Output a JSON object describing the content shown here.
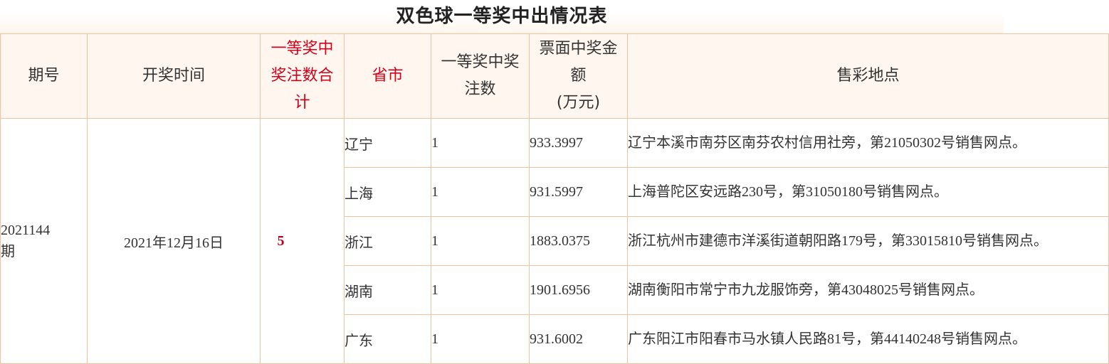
{
  "title": "双色球一等奖中出情况表",
  "headers": {
    "period": "期号",
    "draw_time": "开奖时间",
    "total_line1": "一等奖中",
    "total_line2": "奖注数合",
    "total_line3": "计",
    "province": "省市",
    "count_line1": "一等奖中奖",
    "count_line2": "注数",
    "amount_line1": "票面中奖金",
    "amount_line2": "额",
    "amount_line3": "(万元)",
    "location": "售彩地点"
  },
  "draw": {
    "period_line1": "2021144",
    "period_line2": "期",
    "date": "2021年12月16日",
    "total": "5"
  },
  "rows": [
    {
      "province": "辽宁",
      "count": "1",
      "amount": "933.3997",
      "location": "辽宁本溪市南芬区南芬农村信用社旁，第21050302号销售网点。"
    },
    {
      "province": "上海",
      "count": "1",
      "amount": "931.5997",
      "location": "上海普陀区安远路230号，第31050180号销售网点。"
    },
    {
      "province": "浙江",
      "count": "1",
      "amount": "1883.0375",
      "location": "浙江杭州市建德市洋溪街道朝阳路179号，第33015810号销售网点。"
    },
    {
      "province": "湖南",
      "count": "1",
      "amount": "1901.6956",
      "location": "湖南衡阳市常宁市九龙服饰旁，第43048025号销售网点。"
    },
    {
      "province": "广东",
      "count": "1",
      "amount": "931.6002",
      "location": "广东阳江市阳春市马水镇人民路81号，第44140248号销售网点。"
    }
  ]
}
